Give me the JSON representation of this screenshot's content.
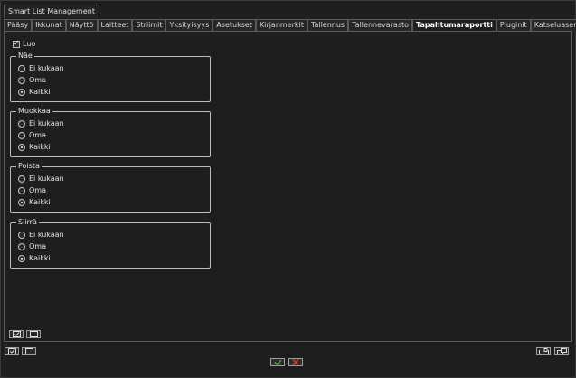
{
  "window": {
    "title": "Smart List Management"
  },
  "tabs": [
    {
      "label": "Pääsy"
    },
    {
      "label": "Ikkunat"
    },
    {
      "label": "Näyttö"
    },
    {
      "label": "Laitteet"
    },
    {
      "label": "Striimit"
    },
    {
      "label": "Yksityisyys"
    },
    {
      "label": "Asetukset"
    },
    {
      "label": "Kirjanmerkit"
    },
    {
      "label": "Tallennus"
    },
    {
      "label": "Tallennevarasto"
    },
    {
      "label": "Tapahtumaraportti"
    },
    {
      "label": "Pluginit"
    },
    {
      "label": "Katseluasemat"
    }
  ],
  "active_tab": "Tapahtumaraportti",
  "luo": {
    "label": "Luo",
    "checked": true
  },
  "groups": [
    {
      "legend": "Näe",
      "options": [
        "Ei kukaan",
        "Oma",
        "Kaikki"
      ],
      "selected": "Kaikki"
    },
    {
      "legend": "Muokkaa",
      "options": [
        "Ei kukaan",
        "Oma",
        "Kaikki"
      ],
      "selected": "Kaikki"
    },
    {
      "legend": "Poista",
      "options": [
        "Ei kukaan",
        "Oma",
        "Kaikki"
      ],
      "selected": "Kaikki"
    },
    {
      "legend": "Siirrä",
      "options": [
        "Ei kukaan",
        "Oma",
        "Kaikki"
      ],
      "selected": "Kaikki"
    }
  ],
  "icons": {
    "select_all": "check-all-icon",
    "select_none": "uncheck-all-icon",
    "dock": "dock-icon",
    "undock": "undock-icon",
    "ok": "checkmark-icon",
    "cancel": "x-icon"
  },
  "colors": {
    "ok": "#3fae2a",
    "cancel": "#d23c2c",
    "background": "#1e1e1e"
  }
}
